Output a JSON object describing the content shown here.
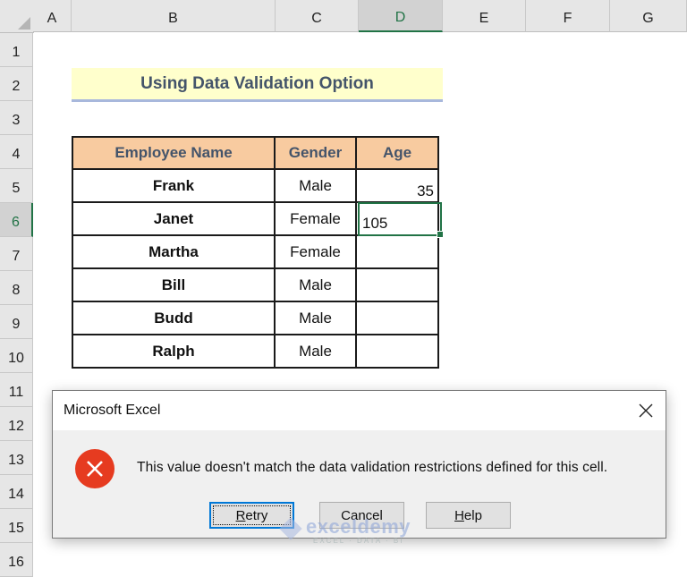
{
  "spreadsheet": {
    "columns": [
      "A",
      "B",
      "C",
      "D",
      "E",
      "F",
      "G"
    ],
    "selected_column": "D",
    "rows": [
      "1",
      "2",
      "3",
      "4",
      "5",
      "6",
      "7",
      "8",
      "9",
      "10",
      "11",
      "12",
      "13",
      "14",
      "15",
      "16"
    ],
    "selected_row": "6",
    "title_cell": "Using Data Validation Option",
    "table": {
      "headers": [
        "Employee Name",
        "Gender",
        "Age"
      ],
      "rows": [
        {
          "name": "Frank",
          "gender": "Male",
          "age": "35"
        },
        {
          "name": "Janet",
          "gender": "Female",
          "age": ""
        },
        {
          "name": "Martha",
          "gender": "Female",
          "age": ""
        },
        {
          "name": "Bill",
          "gender": "Male",
          "age": ""
        },
        {
          "name": "Budd",
          "gender": "Male",
          "age": ""
        },
        {
          "name": "Ralph",
          "gender": "Male",
          "age": ""
        }
      ]
    },
    "active_cell": "D6",
    "active_cell_value": "105",
    "colors": {
      "accent": "#217346",
      "header_fill": "#f8cba0",
      "title_fill": "#ffffcc"
    }
  },
  "dialog": {
    "title": "Microsoft Excel",
    "close_icon": "close-icon",
    "icon": "error-icon",
    "message": "This value doesn't match the data validation restrictions defined for this cell.",
    "buttons": {
      "retry": {
        "prefix": "",
        "mnemonic": "R",
        "suffix": "etry"
      },
      "cancel": {
        "label": "Cancel"
      },
      "help": {
        "prefix": "",
        "mnemonic": "H",
        "suffix": "elp"
      }
    }
  },
  "watermark": {
    "name": "exceldemy",
    "tagline": "EXCEL · DATA · BI"
  }
}
